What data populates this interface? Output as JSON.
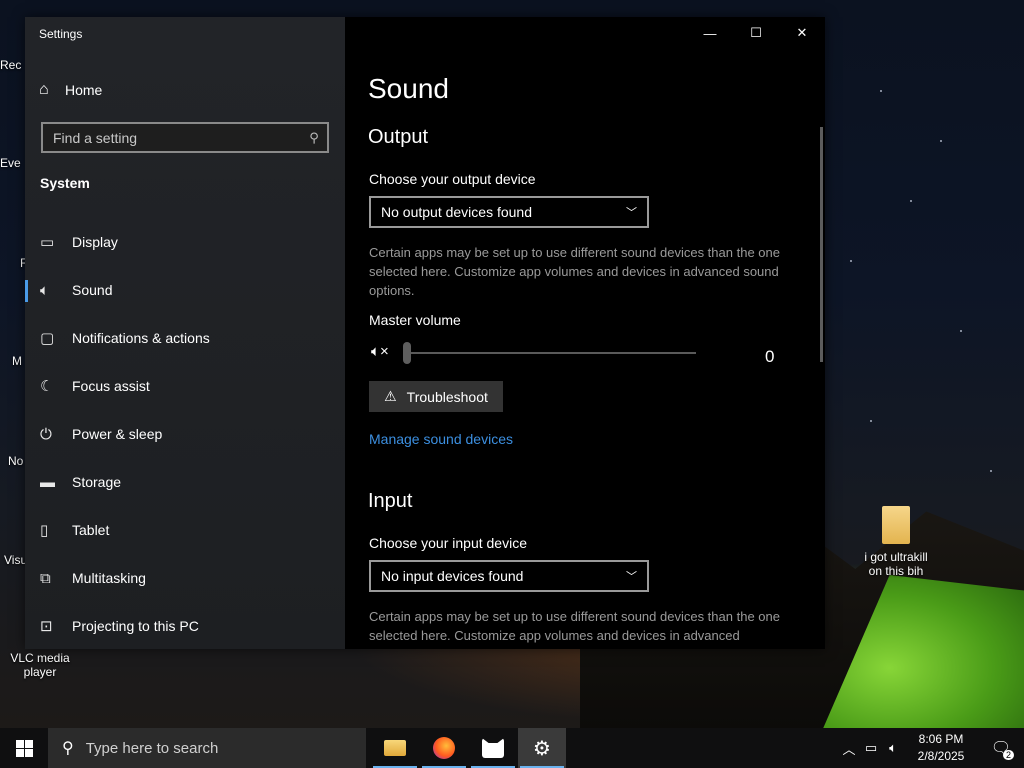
{
  "desktop": {
    "icons": [
      {
        "name": "recycle-bin",
        "label": "Rec"
      },
      {
        "name": "evernote",
        "label": "Eve"
      },
      {
        "name": "app-f",
        "label": "F"
      },
      {
        "name": "app-m",
        "label": "M"
      },
      {
        "name": "notepad",
        "label": "No"
      },
      {
        "name": "vscode",
        "label": "Visu"
      },
      {
        "name": "vlc",
        "label": "VLC media player"
      },
      {
        "name": "folder",
        "label": "i got ultrakill on this bih"
      }
    ]
  },
  "window": {
    "title": "Settings",
    "controls": {
      "minimize": "—",
      "maximize": "☐",
      "close": "✕"
    }
  },
  "sidebar": {
    "home_label": "Home",
    "search_placeholder": "Find a setting",
    "section": "System",
    "items": [
      {
        "label": "Display",
        "icon": "monitor-icon"
      },
      {
        "label": "Sound",
        "icon": "speaker-icon",
        "active": true
      },
      {
        "label": "Notifications & actions",
        "icon": "notification-icon"
      },
      {
        "label": "Focus assist",
        "icon": "moon-icon"
      },
      {
        "label": "Power & sleep",
        "icon": "power-icon"
      },
      {
        "label": "Storage",
        "icon": "storage-icon"
      },
      {
        "label": "Tablet",
        "icon": "tablet-icon"
      },
      {
        "label": "Multitasking",
        "icon": "multitasking-icon"
      },
      {
        "label": "Projecting to this PC",
        "icon": "projecting-icon"
      }
    ]
  },
  "main": {
    "title": "Sound",
    "output": {
      "heading": "Output",
      "choose_label": "Choose your output device",
      "device_value": "No output devices found",
      "description": "Certain apps may be set up to use different sound devices than the one selected here. Customize app volumes and devices in advanced sound options.",
      "master_volume_label": "Master volume",
      "volume_value": "0",
      "volume_level": 0,
      "troubleshoot_label": "Troubleshoot",
      "manage_link": "Manage sound devices"
    },
    "input": {
      "heading": "Input",
      "choose_label": "Choose your input device",
      "device_value": "No input devices found",
      "description": "Certain apps may be set up to use different sound devices than the one selected here. Customize app volumes and devices in advanced"
    }
  },
  "taskbar": {
    "search_placeholder": "Type here to search",
    "apps": [
      {
        "name": "file-explorer",
        "running": true
      },
      {
        "name": "firefox",
        "running": true
      },
      {
        "name": "app-cat",
        "running": true
      },
      {
        "name": "settings",
        "running": true,
        "active": true
      }
    ],
    "time": "8:06 PM",
    "date": "2/8/2025",
    "notification_count": "2"
  }
}
